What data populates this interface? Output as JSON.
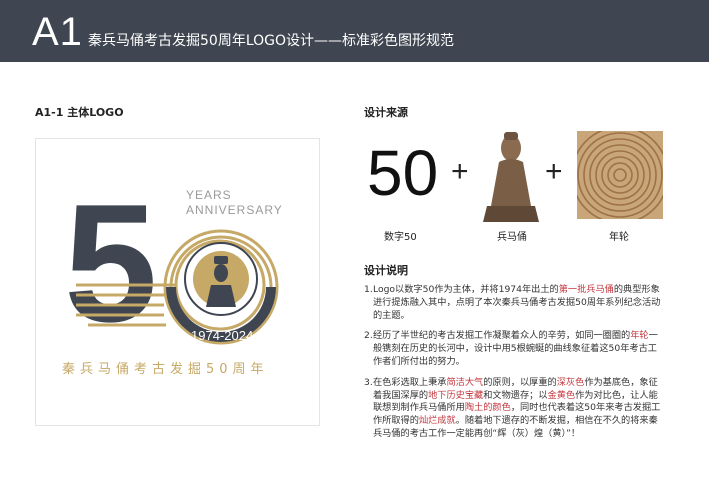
{
  "header": {
    "code": "A1",
    "title": "秦兵马俑考古发掘50周年LOGO设计——标准彩色图形规范"
  },
  "left": {
    "section_title": "A1-1 主体LOGO",
    "logo": {
      "numeral_5": "5",
      "years_line1": "YEARS",
      "years_line2": "ANNIVERSARY",
      "dates": "1974-2024",
      "chinese_name": "秦兵马俑考古发掘50周年",
      "colors": {
        "dark": "#3f4651",
        "gold": "#c7a967",
        "gold_light": "#d9c190"
      }
    }
  },
  "right": {
    "source_title": "设计来源",
    "sources": [
      {
        "visual": "50",
        "caption": "数字50"
      },
      {
        "visual": "warrior-figure",
        "caption": "兵马俑"
      },
      {
        "visual": "tree-rings",
        "caption": "年轮"
      }
    ],
    "plus_sign": "+",
    "notes_title": "设计说明",
    "notes": [
      {
        "index": "1.",
        "parts": [
          {
            "text": "Logo以数字50作为主体，并将1974年出土的",
            "hl": false
          },
          {
            "text": "第一批兵马俑",
            "hl": true
          },
          {
            "text": "的典型形象进行提炼融入其中，点明了本次秦兵马俑考古发掘50周年系列纪念活动的主题。",
            "hl": false
          }
        ]
      },
      {
        "index": "2.",
        "parts": [
          {
            "text": "经历了半世纪的考古发掘工作凝聚着众人的辛劳，如同一圈圈的",
            "hl": false
          },
          {
            "text": "年轮",
            "hl": true
          },
          {
            "text": "一般镌刻在历史的长河中，设计中用5根蜿蜒的曲线象征着这50年考古工作者们所付出的努力。",
            "hl": false
          }
        ]
      },
      {
        "index": "3.",
        "parts": [
          {
            "text": "在色彩选取上秉承",
            "hl": false
          },
          {
            "text": "简洁大气",
            "hl": true
          },
          {
            "text": "的原则，以厚重的",
            "hl": false
          },
          {
            "text": "深灰色",
            "hl": true
          },
          {
            "text": "作为基底色，象征着我国深厚的",
            "hl": false
          },
          {
            "text": "地下历史宝藏",
            "hl": true
          },
          {
            "text": "和文物遗存；以",
            "hl": false
          },
          {
            "text": "金黄色",
            "hl": true
          },
          {
            "text": "作为对比色，让人能联想到制作兵马俑所用",
            "hl": false
          },
          {
            "text": "陶土的颜色",
            "hl": true
          },
          {
            "text": "，同时也代表着这50年来考古发掘工作所取得的",
            "hl": false
          },
          {
            "text": "灿烂成就",
            "hl": true
          },
          {
            "text": "。随着地下遗存的不断发掘，相信在不久的将来秦兵马俑的考古工作一定能再创“辉（灰）煌（黄）”！",
            "hl": false
          }
        ]
      }
    ]
  }
}
